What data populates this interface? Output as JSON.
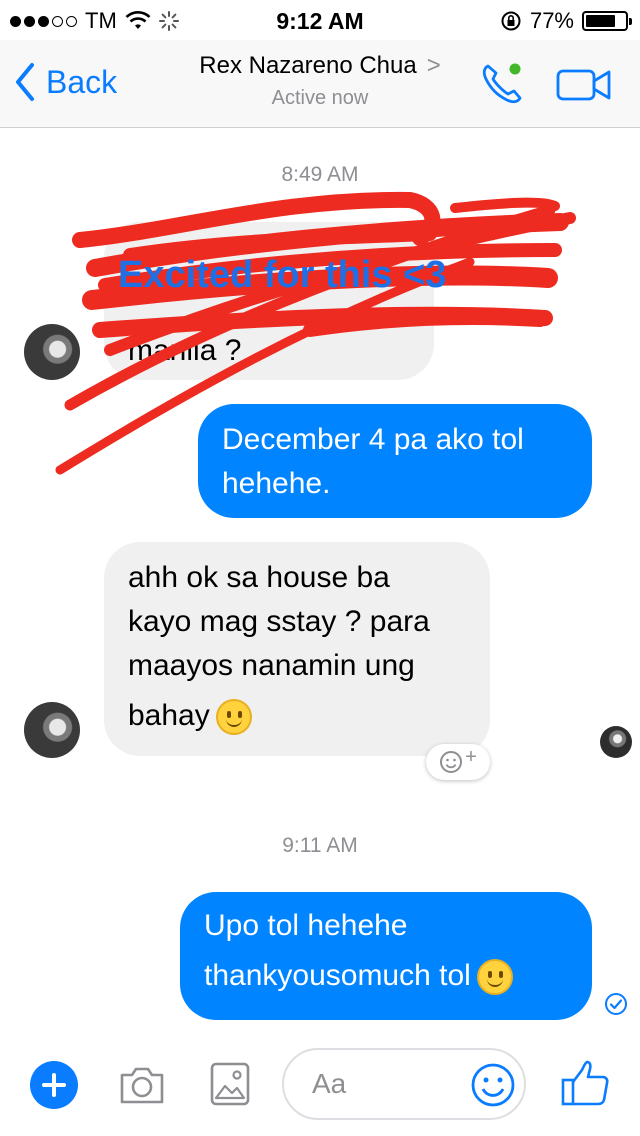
{
  "status_bar": {
    "carrier": "TM",
    "time": "9:12 AM",
    "battery": "77%",
    "battery_level": 0.77
  },
  "header": {
    "back_label": "Back",
    "contact_name": "Rex Nazareno Chua",
    "chevron": ">",
    "status": "Active now"
  },
  "messages": {
    "timestamp_1": "8:49 AM",
    "scribbled_text": "manila ?",
    "overlay_caption": "Excited for this <3",
    "out_1_line1": "December 4 pa ako tol",
    "out_1_line2": "hehehe.",
    "in_2_line1": "ahh ok sa house ba",
    "in_2_line2": "kayo mag sstay ? para",
    "in_2_line3": "maayos nanamin ung",
    "in_2_line4": "bahay",
    "timestamp_2": "9:11 AM",
    "out_2_line1": "Upo tol hehehe",
    "out_2_line2": "thankyousomuch tol"
  },
  "composer": {
    "placeholder": "Aa"
  },
  "colors": {
    "accent": "#0a7cff",
    "outgoing_bubble": "#0084ff",
    "incoming_bubble": "#f1f0f0",
    "scribble": "#ee2b20"
  }
}
